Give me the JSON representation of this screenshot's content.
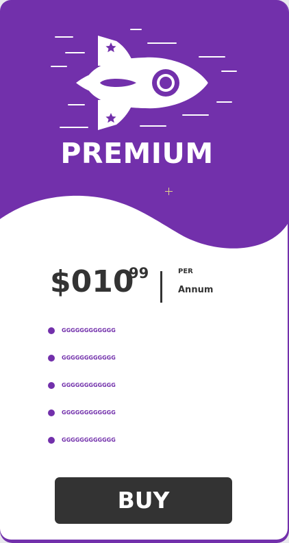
{
  "plan": {
    "title": "PREMIUM",
    "icon": "rocket-icon"
  },
  "price": {
    "main": "$010",
    "cents": "99",
    "per_label": "PER",
    "period": "Annum"
  },
  "features": [
    "GGGGGGGGGGGG",
    "GGGGGGGGGGGG",
    "GGGGGGGGGGGG",
    "GGGGGGGGGGGG",
    "GGGGGGGGGGGG"
  ],
  "buy_button": {
    "label": "BUY"
  },
  "colors": {
    "accent": "#7230ab",
    "dark": "#333333",
    "background": "#ffffff"
  }
}
